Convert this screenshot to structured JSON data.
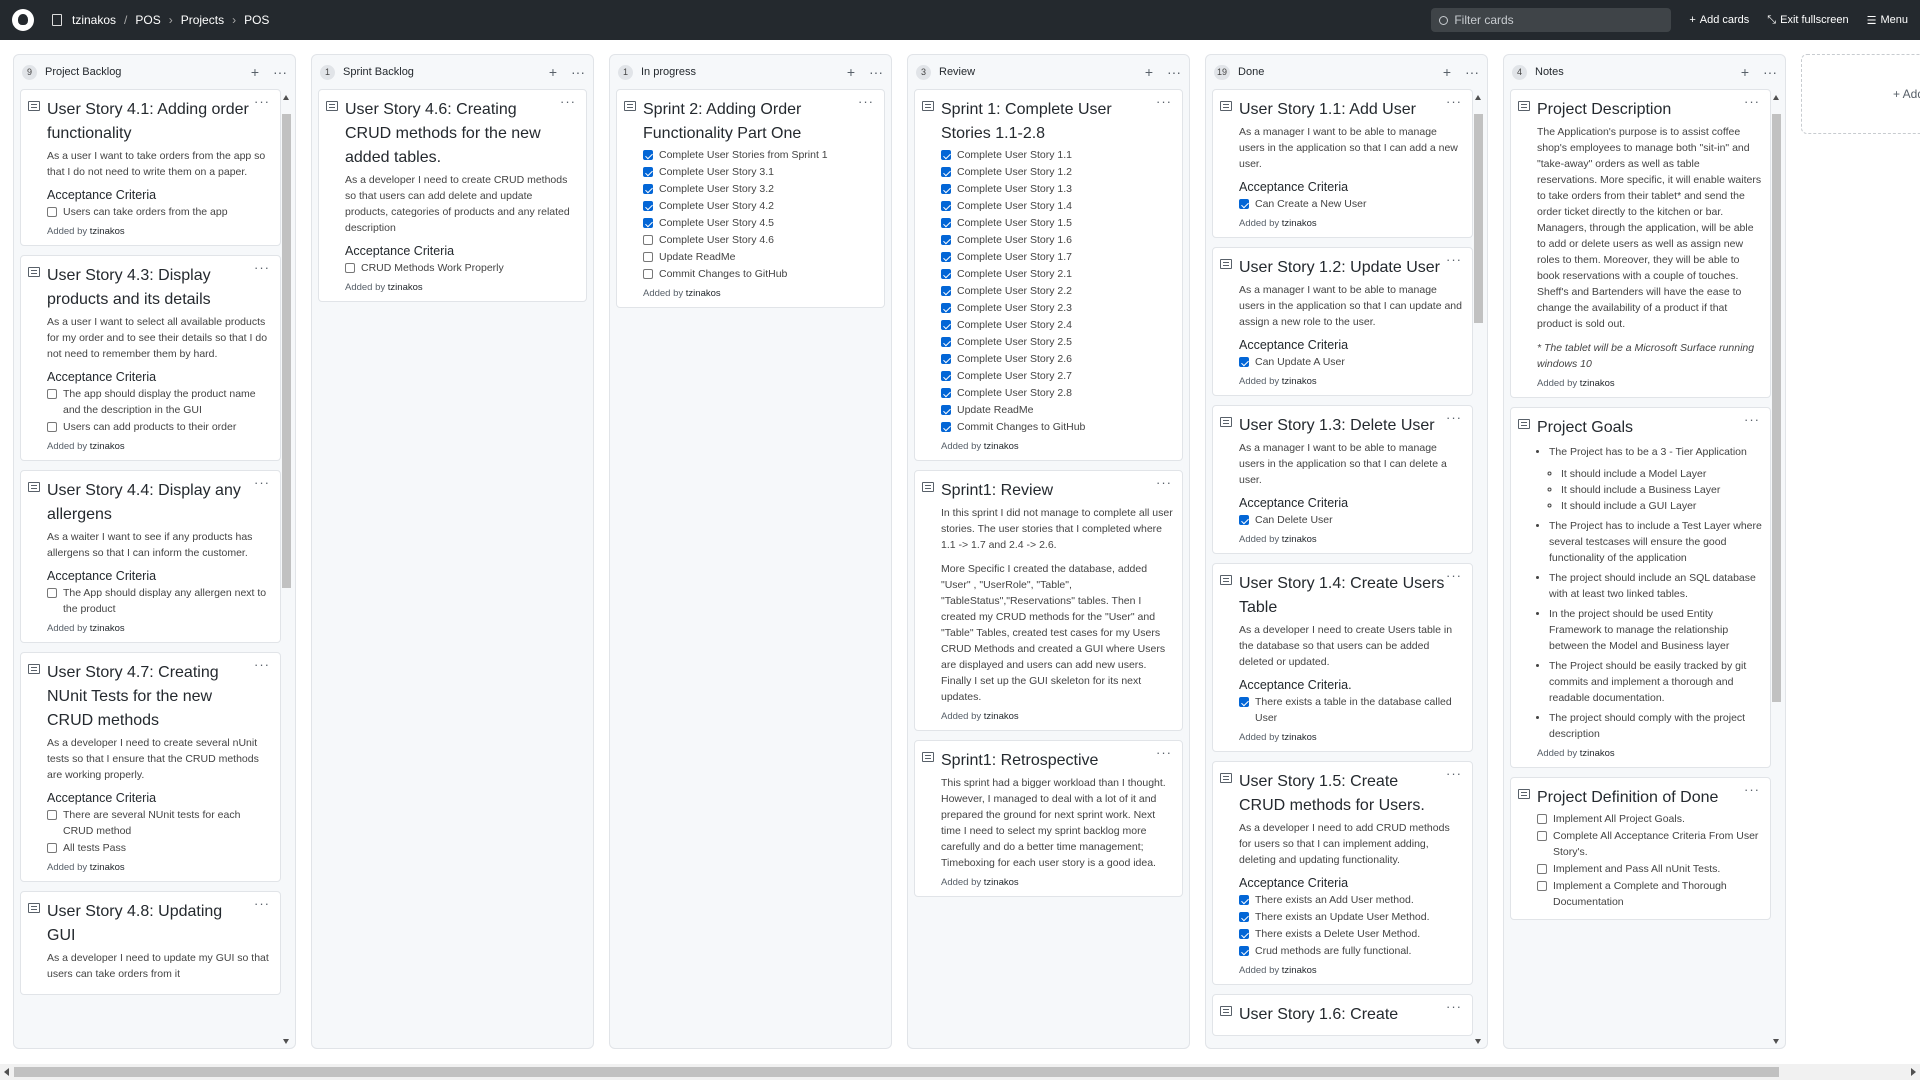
{
  "header": {
    "owner": "tzinakos",
    "repo": "POS",
    "projects": "Projects",
    "project": "POS",
    "filter_placeholder": "Filter cards",
    "add_cards": "Add cards",
    "exit_fullscreen": "Exit fullscreen",
    "menu": "Menu"
  },
  "columns": [
    {
      "count": "9",
      "title": "Project Backlog",
      "cards": [
        {
          "title": "User Story 4.1: Adding order functionality",
          "body": "As a user I want to take orders from the app so that I do not need to write them on a paper.",
          "criteria_title": "Acceptance Criteria",
          "checks": [
            {
              "text": "Users can take orders from the app",
              "checked": false
            }
          ],
          "added_label": "Added by",
          "author": "tzinakos"
        },
        {
          "title": "User Story 4.3: Display products and its details",
          "body": "As a user I want to select all available products for my order and to see their details so that I do not need to remember them by hard.",
          "criteria_title": "Acceptance Criteria",
          "checks": [
            {
              "text": "The app should display the product name and the description in the GUI",
              "checked": false
            },
            {
              "text": "Users can add products to their order",
              "checked": false
            }
          ],
          "added_label": "Added by",
          "author": "tzinakos"
        },
        {
          "title": "User Story 4.4: Display any allergens",
          "body": "As a waiter I want to see if any products has allergens so that I can inform the customer.",
          "criteria_title": "Acceptance Criteria",
          "checks": [
            {
              "text": "The App should display any allergen next to the product",
              "checked": false
            }
          ],
          "added_label": "Added by",
          "author": "tzinakos"
        },
        {
          "title": "User Story 4.7: Creating NUnit Tests for the new CRUD methods",
          "body": "As a developer I need to create several nUnit tests so that I ensure that the CRUD methods are working properly.",
          "criteria_title": "Acceptance Criteria",
          "checks": [
            {
              "text": "There are several NUnit tests for each CRUD method",
              "checked": false
            },
            {
              "text": "All tests Pass",
              "checked": false
            }
          ],
          "added_label": "Added by",
          "author": "tzinakos"
        },
        {
          "title": "User Story 4.8: Updating GUI",
          "body": "As a developer I need to update my GUI so that users can take orders from it",
          "criteria_title": "",
          "checks": [],
          "added_label": "",
          "author": ""
        }
      ]
    },
    {
      "count": "1",
      "title": "Sprint Backlog",
      "cards": [
        {
          "title": "User Story 4.6: Creating CRUD methods for the new added tables.",
          "body": "As a developer I need to create CRUD methods so that users can add delete and update products, categories of products and any related description",
          "criteria_title": "Acceptance Criteria",
          "checks": [
            {
              "text": "CRUD Methods Work Properly",
              "checked": false
            }
          ],
          "added_label": "Added by",
          "author": "tzinakos"
        }
      ]
    },
    {
      "count": "1",
      "title": "In progress",
      "cards": [
        {
          "title": "Sprint 2: Adding Order Functionality Part One",
          "body": "",
          "criteria_title": "",
          "checks": [
            {
              "text": "Complete User Stories from Sprint 1",
              "checked": true
            },
            {
              "text": "Complete User Story 3.1",
              "checked": true
            },
            {
              "text": "Complete User Story 3.2",
              "checked": true
            },
            {
              "text": "Complete User Story 4.2",
              "checked": true
            },
            {
              "text": "Complete User Story 4.5",
              "checked": true
            },
            {
              "text": "Complete User Story 4.6",
              "checked": false
            },
            {
              "text": "Update ReadMe",
              "checked": false
            },
            {
              "text": "Commit Changes to GitHub",
              "checked": false
            }
          ],
          "added_label": "Added by",
          "author": "tzinakos"
        }
      ]
    },
    {
      "count": "3",
      "title": "Review",
      "cards": [
        {
          "title": "Sprint 1: Complete User Stories 1.1-2.8",
          "body": "",
          "criteria_title": "",
          "checks": [
            {
              "text": "Complete User Story 1.1",
              "checked": true
            },
            {
              "text": "Complete User Story 1.2",
              "checked": true
            },
            {
              "text": "Complete User Story 1.3",
              "checked": true
            },
            {
              "text": "Complete User Story 1.4",
              "checked": true
            },
            {
              "text": "Complete User Story 1.5",
              "checked": true
            },
            {
              "text": "Complete User Story 1.6",
              "checked": true
            },
            {
              "text": "Complete User Story 1.7",
              "checked": true
            },
            {
              "text": "Complete User Story 2.1",
              "checked": true
            },
            {
              "text": "Complete User Story 2.2",
              "checked": true
            },
            {
              "text": "Complete User Story 2.3",
              "checked": true
            },
            {
              "text": "Complete User Story 2.4",
              "checked": true
            },
            {
              "text": "Complete User Story 2.5",
              "checked": true
            },
            {
              "text": "Complete User Story 2.6",
              "checked": true
            },
            {
              "text": "Complete User Story 2.7",
              "checked": true
            },
            {
              "text": "Complete User Story 2.8",
              "checked": true
            },
            {
              "text": "Update ReadMe",
              "checked": true
            },
            {
              "text": "Commit Changes to GitHub",
              "checked": true
            }
          ],
          "added_label": "Added by",
          "author": "tzinakos"
        },
        {
          "title": "Sprint1: Review",
          "body": "In this sprint I did not manage to complete all user stories. The user stories that I completed where 1.1 -> 1.7 and 2.4 -> 2.6.",
          "body2": "More Specific I created the database, added \"User\" , \"UserRole\", \"Table\", \"TableStatus\",\"Reservations\" tables. Then I created my CRUD methods for the \"User\" and \"Table\" Tables, created test cases for my Users CRUD Methods and created a GUI where Users are displayed and users can add new users. Finally I set up the GUI skeleton for its next updates.",
          "criteria_title": "",
          "checks": [],
          "added_label": "Added by",
          "author": "tzinakos"
        },
        {
          "title": "Sprint1: Retrospective",
          "body": "This sprint had a bigger workload than I thought. However, I managed to deal with a lot of it and prepared the ground for next sprint work. Next time I need to select my sprint backlog more carefully and do a better time management; Timeboxing for each user story is a good idea.",
          "criteria_title": "",
          "checks": [],
          "added_label": "Added by",
          "author": "tzinakos"
        }
      ]
    },
    {
      "count": "19",
      "title": "Done",
      "cards": [
        {
          "title": "User Story 1.1: Add User",
          "body": "As a manager I want to be able to manage users in the application so that I can add a new user.",
          "criteria_title": "Acceptance Criteria",
          "checks": [
            {
              "text": "Can Create a New User",
              "checked": true
            }
          ],
          "added_label": "Added by",
          "author": "tzinakos"
        },
        {
          "title": "User Story 1.2: Update User",
          "body": "As a manager I want to be able to manage users in the application so that I can update and assign a new role to the user.",
          "criteria_title": "Acceptance Criteria",
          "checks": [
            {
              "text": "Can Update A User",
              "checked": true
            }
          ],
          "added_label": "Added by",
          "author": "tzinakos"
        },
        {
          "title": "User Story 1.3: Delete User",
          "body": "As a manager I want to be able to manage users in the application so that I can delete a user.",
          "criteria_title": "Acceptance Criteria",
          "checks": [
            {
              "text": "Can Delete User",
              "checked": true
            }
          ],
          "added_label": "Added by",
          "author": "tzinakos"
        },
        {
          "title": "User Story 1.4: Create Users Table",
          "body": "As a developer I need to create Users table in the database so that users can be added deleted or updated.",
          "criteria_title": "Acceptance Criteria.",
          "checks": [
            {
              "text": "There exists a table in the database called User",
              "checked": true
            }
          ],
          "added_label": "Added by",
          "author": "tzinakos"
        },
        {
          "title": "User Story 1.5: Create CRUD methods for Users.",
          "body": "As a developer I need to add CRUD methods for users so that I can implement adding, deleting and updating functionality.",
          "criteria_title": "Acceptance Criteria",
          "checks": [
            {
              "text": "There exists an Add User method.",
              "checked": true
            },
            {
              "text": "There exists an Update User Method.",
              "checked": true
            },
            {
              "text": "There exists a Delete User Method.",
              "checked": true
            },
            {
              "text": "Crud methods are fully functional.",
              "checked": true
            }
          ],
          "added_label": "Added by",
          "author": "tzinakos"
        },
        {
          "title": "User Story 1.6: Create",
          "body": "",
          "criteria_title": "",
          "checks": [],
          "added_label": "",
          "author": ""
        }
      ]
    },
    {
      "count": "4",
      "title": "Notes",
      "cards": [
        {
          "title": "Project Description",
          "body": "The Application's purpose is to assist coffee shop's employees to manage both \"sit-in\" and \"take-away\" orders as well as table reservations. More specific, it will enable waiters to take orders from their tablet* and send the order ticket directly to the kitchen or bar. Managers, through the application, will be able to add or delete users as well as assign new roles to them. Moreover, they will be able to book reservations with a couple of touches. Sheff's and Bartenders will have the ease to change the availability of a product if that product is sold out.",
          "footnote": "* The tablet will be a Microsoft Surface running windows 10",
          "criteria_title": "",
          "checks": [],
          "added_label": "Added by",
          "author": "tzinakos"
        },
        {
          "title": "Project Goals",
          "goals": [
            {
              "text": "The Project has to be a 3 - Tier Application",
              "sub": [
                "It should include a Model Layer",
                "It should include a Business Layer",
                "It should include a GUI Layer"
              ]
            },
            {
              "text": "The Project has to include a Test Layer where several testcases will ensure the good functionality of the application",
              "sub": []
            },
            {
              "text": "The project should include an SQL database with at least two linked tables.",
              "sub": []
            },
            {
              "text": "In the project should be used Entity Framework to manage the relationship between the Model and Business layer",
              "sub": []
            },
            {
              "text": "The Project should be easily tracked by git commits and implement a thorough and readable documentation.",
              "sub": []
            },
            {
              "text": "The project should comply with the project description",
              "sub": []
            }
          ],
          "criteria_title": "",
          "checks": [],
          "added_label": "Added by",
          "author": "tzinakos"
        },
        {
          "title": "Project Definition of Done",
          "body": "",
          "criteria_title": "",
          "checks": [
            {
              "text": "Implement All Project Goals.",
              "checked": false
            },
            {
              "text": "Complete All Acceptance Criteria From User Story's.",
              "checked": false
            },
            {
              "text": "Implement and Pass All nUnit Tests.",
              "checked": false
            },
            {
              "text": "Implement a Complete and Thorough Documentation",
              "checked": false
            }
          ],
          "added_label": "",
          "author": ""
        }
      ]
    }
  ],
  "add_column_label": "+ Add"
}
